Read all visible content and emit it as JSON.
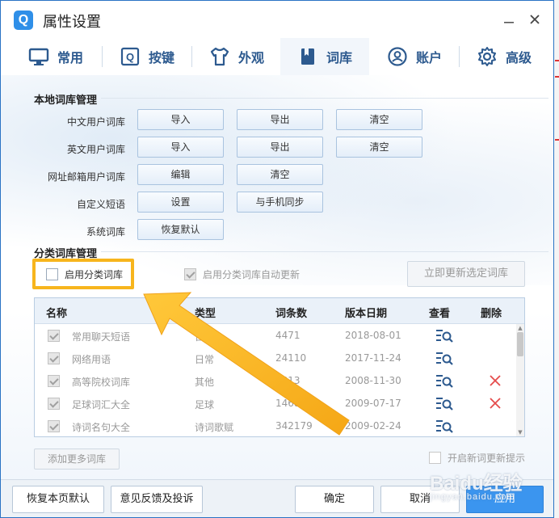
{
  "window": {
    "title": "属性设置",
    "app_icon": "Q"
  },
  "tabs": [
    {
      "label": "常用",
      "icon": "monitor-icon"
    },
    {
      "label": "按键",
      "icon": "key-icon"
    },
    {
      "label": "外观",
      "icon": "shirt-icon"
    },
    {
      "label": "词库",
      "icon": "book-icon",
      "active": true
    },
    {
      "label": "账户",
      "icon": "user-icon"
    },
    {
      "label": "高级",
      "icon": "gear-icon"
    }
  ],
  "local": {
    "title": "本地词库管理",
    "rows": [
      {
        "label": "中文用户词库",
        "buttons": [
          "导入",
          "导出",
          "清空"
        ]
      },
      {
        "label": "英文用户词库",
        "buttons": [
          "导入",
          "导出",
          "清空"
        ]
      },
      {
        "label": "网址邮箱用户词库",
        "buttons": [
          "编辑",
          "清空"
        ]
      },
      {
        "label": "自定义短语",
        "buttons": [
          "设置",
          "与手机同步"
        ]
      },
      {
        "label": "系统词库",
        "buttons": [
          "恢复默认"
        ]
      }
    ]
  },
  "category": {
    "title": "分类词库管理",
    "enable_label": "启用分类词库",
    "auto_update_label": "启用分类词库自动更新",
    "update_now_label": "立即更新选定词库",
    "columns": [
      "名称",
      "类型",
      "词条数",
      "版本日期",
      "查看",
      "删除"
    ],
    "rows": [
      {
        "name": "常用聊天短语",
        "type": "日常",
        "count": "4471",
        "date": "2018-08-01",
        "deletable": false
      },
      {
        "name": "网络用语",
        "type": "日常",
        "count": "24110",
        "date": "2017-11-24",
        "deletable": false
      },
      {
        "name": "高等院校词库",
        "type": "其他",
        "count": "2813",
        "date": "2008-11-30",
        "deletable": true
      },
      {
        "name": "足球词汇大全",
        "type": "足球",
        "count": "14689",
        "date": "2009-07-17",
        "deletable": true
      },
      {
        "name": "诗词名句大全",
        "type": "诗词歌赋",
        "count": "342179",
        "date": "2009-02-24",
        "deletable": false
      }
    ],
    "add_more_label": "添加更多词库",
    "new_update_tip_label": "开启新词更新提示"
  },
  "footer": {
    "restore_label": "恢复本页默认",
    "feedback_label": "意见反馈及投诉",
    "ok_label": "确定",
    "cancel_label": "取消",
    "apply_label": "应用"
  },
  "watermark": {
    "brand": "Baidu经验",
    "sub": "jingyan.baidu.com"
  },
  "colors": {
    "accent": "#2f8fe8",
    "highlight": "#f7b51d",
    "delete": "#e54b4b",
    "tab_text": "#2d5a8f"
  }
}
